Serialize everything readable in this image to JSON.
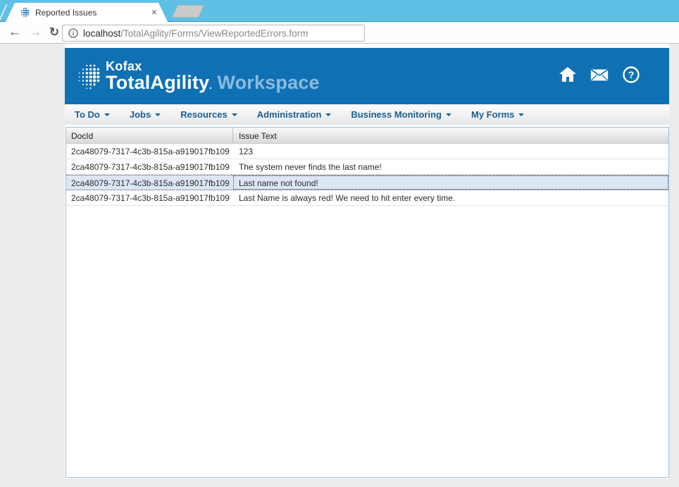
{
  "browser": {
    "tab_title": "Reported Issues",
    "close_icon": "×",
    "back_icon": "←",
    "forward_icon": "→",
    "refresh_icon": "↻",
    "url_host": "localhost",
    "url_path": "/TotalAgility/Forms/ViewReportedErrors.form"
  },
  "header": {
    "brand_kofax": "Kofax",
    "brand_product": "TotalAgility",
    "brand_workspace": "Workspace",
    "help_icon_glyph": "?"
  },
  "nav": {
    "items": [
      {
        "label": "To Do"
      },
      {
        "label": "Jobs"
      },
      {
        "label": "Resources"
      },
      {
        "label": "Administration"
      },
      {
        "label": "Business Monitoring"
      },
      {
        "label": "My Forms"
      }
    ]
  },
  "grid": {
    "columns": [
      {
        "label": "DocId"
      },
      {
        "label": "Issue Text"
      }
    ],
    "rows": [
      {
        "doc_id": "2ca48079-7317-4c3b-815a-a919017fb109",
        "issue_text": "123",
        "selected": false
      },
      {
        "doc_id": "2ca48079-7317-4c3b-815a-a919017fb109",
        "issue_text": "The system never finds the last name!",
        "selected": false
      },
      {
        "doc_id": "2ca48079-7317-4c3b-815a-a919017fb109",
        "issue_text": "Last name not found!",
        "selected": true
      },
      {
        "doc_id": "2ca48079-7317-4c3b-815a-a919017fb109",
        "issue_text": "Last Name is always red! We need to hit enter every time.",
        "selected": false
      }
    ]
  },
  "colors": {
    "chrome_frame": "#5fc0e6",
    "header_bg": "#0f71b4",
    "workspace_text": "#8cbbdd",
    "nav_link": "#1a5f93",
    "selected_row_bg": "#dce6f5",
    "grid_border": "#9ebfe3"
  }
}
